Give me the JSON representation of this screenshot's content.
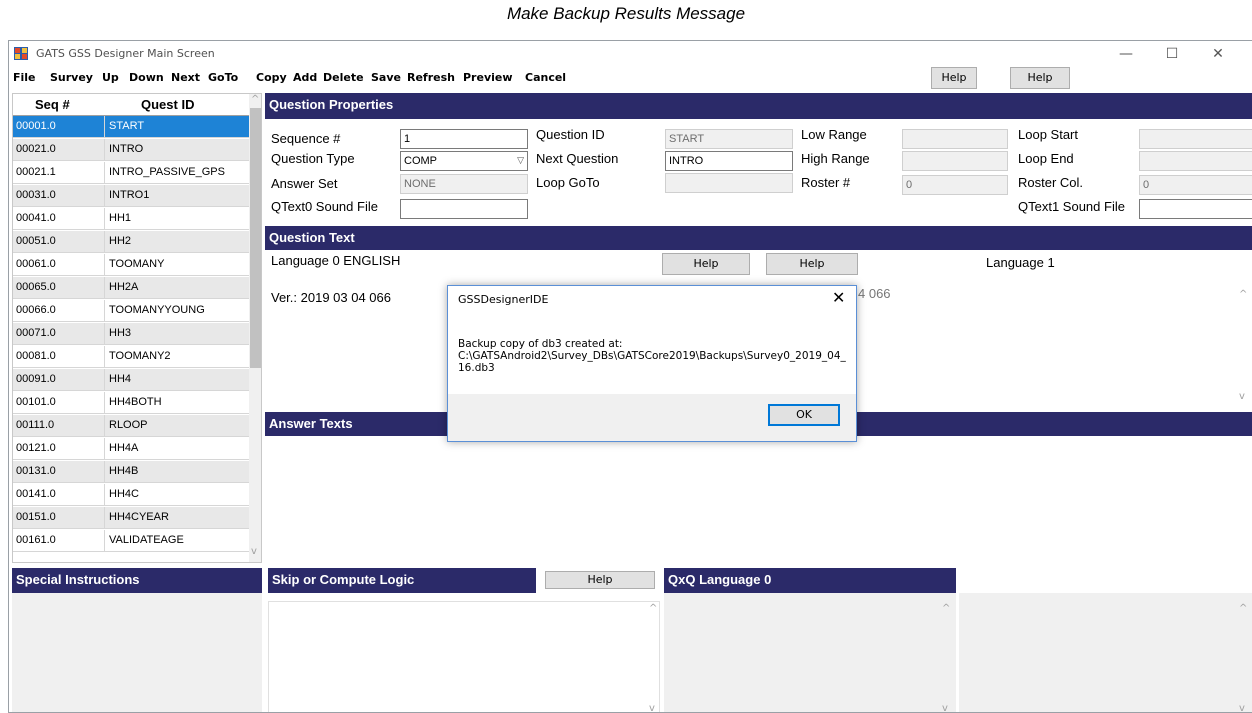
{
  "caption": "Make Backup Results Message",
  "window": {
    "title": "GATS GSS Designer Main Screen",
    "controls": {
      "minimize": "—",
      "maximize": "☐",
      "close": "✕"
    }
  },
  "menu": [
    "File",
    "Survey",
    "Up",
    "Down",
    "Next",
    "GoTo",
    "Copy",
    "Add",
    "Delete",
    "Save",
    "Refresh",
    "Preview",
    "Cancel"
  ],
  "help_buttons": {
    "menu_help_1": "Help",
    "menu_help_2": "Help",
    "text_help_1": "Help",
    "text_help_2": "Help",
    "skip_help": "Help"
  },
  "list": {
    "headers": {
      "seq": "Seq #",
      "quest": "Quest ID"
    },
    "rows": [
      {
        "seq": "00001.0",
        "id": "START"
      },
      {
        "seq": "00021.0",
        "id": "INTRO"
      },
      {
        "seq": "00021.1",
        "id": "INTRO_PASSIVE_GPS"
      },
      {
        "seq": "00031.0",
        "id": "INTRO1"
      },
      {
        "seq": "00041.0",
        "id": "HH1"
      },
      {
        "seq": "00051.0",
        "id": "HH2"
      },
      {
        "seq": "00061.0",
        "id": "TOOMANY"
      },
      {
        "seq": "00065.0",
        "id": "HH2A"
      },
      {
        "seq": "00066.0",
        "id": "TOOMANYYOUNG"
      },
      {
        "seq": "00071.0",
        "id": "HH3"
      },
      {
        "seq": "00081.0",
        "id": "TOOMANY2"
      },
      {
        "seq": "00091.0",
        "id": "HH4"
      },
      {
        "seq": "00101.0",
        "id": "HH4BOTH"
      },
      {
        "seq": "00111.0",
        "id": "RLOOP"
      },
      {
        "seq": "00121.0",
        "id": "HH4A"
      },
      {
        "seq": "00131.0",
        "id": "HH4B"
      },
      {
        "seq": "00141.0",
        "id": "HH4C"
      },
      {
        "seq": "00151.0",
        "id": "HH4CYEAR"
      },
      {
        "seq": "00161.0",
        "id": "VALIDATEAGE"
      }
    ]
  },
  "props": {
    "section": "Question Properties",
    "sequence_label": "Sequence #",
    "sequence_value": "1",
    "qtype_label": "Question Type",
    "qtype_value": "COMP",
    "answerset_label": "Answer Set",
    "answerset_value": "NONE",
    "qtext0_label": "QText0 Sound File",
    "qtext0_value": "",
    "qid_label": "Question ID",
    "qid_value": "START",
    "nextq_label": "Next Question",
    "nextq_value": "INTRO",
    "loopgoto_label": "Loop GoTo",
    "loopgoto_value": "",
    "lowrange_label": "Low Range",
    "lowrange_value": "",
    "highrange_label": "High Range",
    "highrange_value": "",
    "roster_label": "Roster #",
    "roster_value": "0",
    "loopstart_label": "Loop Start",
    "loopstart_value": "",
    "loopend_label": "Loop End",
    "loopend_value": "",
    "rostercol_label": "Roster Col.",
    "rostercol_value": "0",
    "qtext1_label": "QText1 Sound File",
    "qtext1_value": ""
  },
  "qtext": {
    "section": "Question Text",
    "lang0": "Language 0 ENGLISH",
    "lang1": "Language 1",
    "version": "Ver.: 2019 03 04 066",
    "version_tail": "4 066"
  },
  "answer_texts": "Answer Texts",
  "special_instructions": "Special Instructions",
  "skip_logic": "Skip or Compute Logic",
  "qxq": "QxQ Language 0",
  "dialog": {
    "title": "GSSDesignerIDE",
    "message_line1": "Backup copy of db3 created at:",
    "message_line2": "C:\\GATSAndroid2\\Survey_DBs\\GATSCore2019\\Backups\\Survey0_2019_04_",
    "message_line3": "16.db3",
    "ok": "OK"
  }
}
